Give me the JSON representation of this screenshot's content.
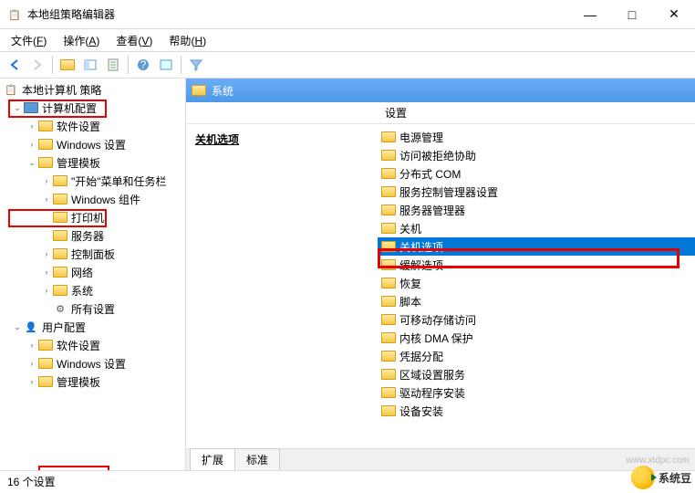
{
  "window": {
    "title": "本地组策略编辑器",
    "controls": {
      "minimize": "—",
      "maximize": "□",
      "close": "✕"
    }
  },
  "menus": [
    {
      "label": "文件",
      "accel": "F"
    },
    {
      "label": "操作",
      "accel": "A"
    },
    {
      "label": "查看",
      "accel": "V"
    },
    {
      "label": "帮助",
      "accel": "H"
    }
  ],
  "tree": {
    "root": "本地计算机 策略",
    "nodes": {
      "computer_config": "计算机配置",
      "software_settings1": "软件设置",
      "windows_settings1": "Windows 设置",
      "admin_templates1": "管理模板",
      "start_menu_taskbar": "\"开始\"菜单和任务栏",
      "windows_components": "Windows 组件",
      "printers": "打印机",
      "servers": "服务器",
      "control_panel": "控制面板",
      "network": "网络",
      "system": "系统",
      "all_settings": "所有设置",
      "user_config": "用户配置",
      "software_settings2": "软件设置",
      "windows_settings2": "Windows 设置",
      "admin_templates2": "管理模板"
    }
  },
  "content": {
    "path_title": "系统",
    "desc_heading": "关机选项",
    "list_header": "设置",
    "items": [
      "电源管理",
      "访问被拒绝协助",
      "分布式 COM",
      "服务控制管理器设置",
      "服务器管理器",
      "关机",
      "关机选项",
      "缓解选项",
      "恢复",
      "脚本",
      "可移动存储访问",
      "内核 DMA 保护",
      "凭据分配",
      "区域设置服务",
      "驱动程序安装",
      "设备安装"
    ]
  },
  "tabs": {
    "extended": "扩展",
    "standard": "标准"
  },
  "status": "16 个设置",
  "watermark": {
    "brand": "系统豆",
    "url": "www.xtdpc.com"
  }
}
